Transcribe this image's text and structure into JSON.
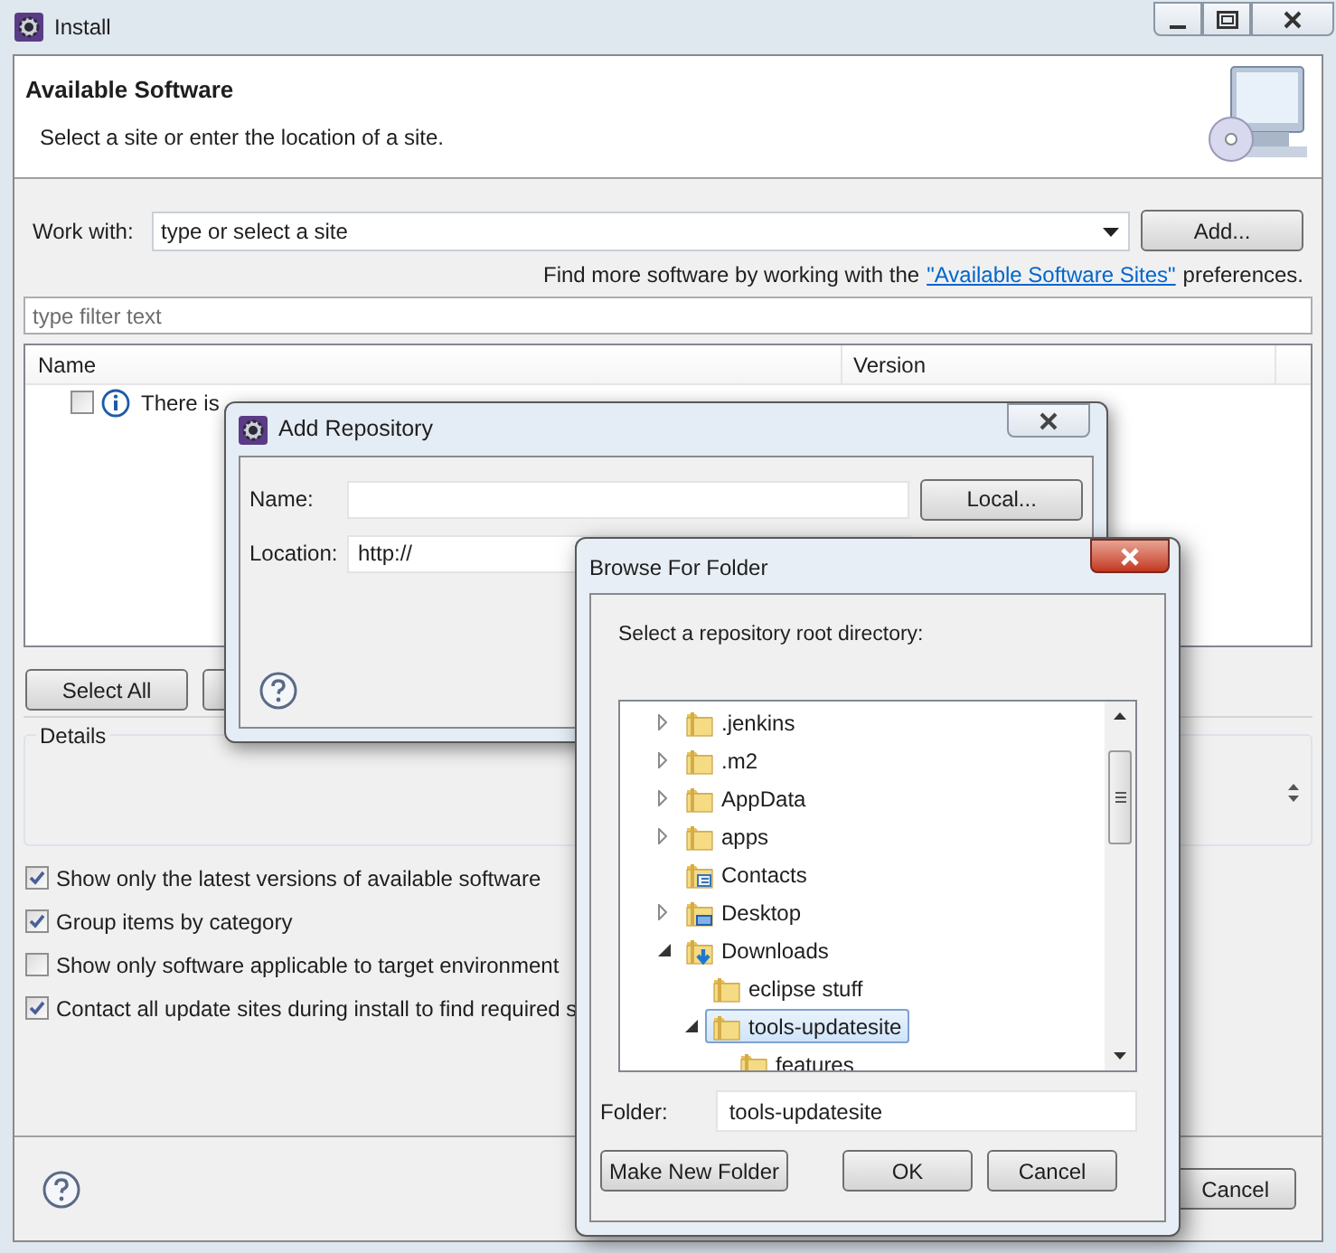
{
  "window": {
    "title": "Install"
  },
  "header": {
    "title": "Available Software",
    "subtitle": "Select a site or enter the location of a site."
  },
  "work_with": {
    "label": "Work with:",
    "placeholder": "type or select a site",
    "button": "Add..."
  },
  "more_software": {
    "prefix": "Find more software by working with the",
    "link": "\"Available Software Sites\"",
    "suffix": "preferences."
  },
  "filter": {
    "placeholder": "type filter text"
  },
  "table": {
    "columns": [
      "Name",
      "Version"
    ],
    "rows": [
      {
        "name": "There is",
        "checked": false
      }
    ]
  },
  "buttons": [
    "Select All"
  ],
  "details": {
    "label": "Details"
  },
  "options": [
    {
      "label": "Show only the latest versions of available software",
      "checked": true
    },
    {
      "label": "Group items by category",
      "checked": true
    },
    {
      "label": "Show only software applicable to target environment",
      "checked": false
    },
    {
      "label": "Contact all update sites during install to find required s",
      "checked": true
    }
  ],
  "footer": {
    "cancel": "Cancel"
  },
  "add_repository": {
    "title": "Add Repository",
    "name_label": "Name:",
    "location_label": "Location:",
    "location_value": "http://",
    "local_button": "Local..."
  },
  "browse_folder": {
    "title": "Browse For Folder",
    "prompt": "Select a repository root directory:",
    "tree": [
      {
        "label": ".jenkins",
        "kind": "folder",
        "expanded": false,
        "selected": false
      },
      {
        "label": ".m2",
        "kind": "folder",
        "expanded": false,
        "selected": false
      },
      {
        "label": "AppData",
        "kind": "folder",
        "expanded": false,
        "selected": false
      },
      {
        "label": "apps",
        "kind": "folder",
        "expanded": false,
        "selected": false
      },
      {
        "label": "Contacts",
        "kind": "contacts",
        "selected": false
      },
      {
        "label": "Desktop",
        "kind": "desktop",
        "expanded": false,
        "selected": false
      },
      {
        "label": "Downloads",
        "kind": "downloads",
        "expanded": true,
        "selected": false,
        "children": [
          {
            "label": "eclipse stuff",
            "selected": false
          },
          {
            "label": "tools-updatesite",
            "expanded": true,
            "selected": true,
            "children": [
              {
                "label": "features",
                "selected": false
              }
            ]
          }
        ]
      }
    ],
    "folder_label": "Folder:",
    "folder_value": "tools-updatesite",
    "buttons": [
      "Make New Folder",
      "OK",
      "Cancel"
    ]
  }
}
